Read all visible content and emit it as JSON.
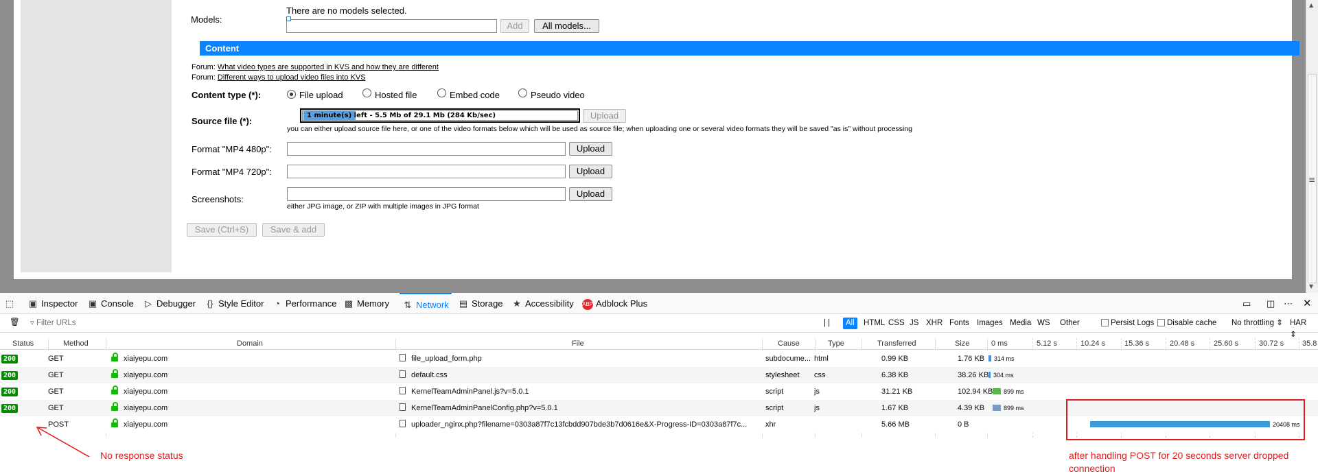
{
  "form": {
    "models_label": "Models:",
    "models_empty": "There are no models selected.",
    "add_button": "Add",
    "all_models_button": "All models...",
    "section_title": "Content",
    "forum_prefix": "Forum:",
    "forum_link_1": "What video types are supported in KVS and how they are different",
    "forum_link_2": "Different ways to upload video files into KVS",
    "content_type_label": "Content type (*):",
    "content_types": [
      "File upload",
      "Hosted file",
      "Embed code",
      "Pseudo video"
    ],
    "content_type_selected": "File upload",
    "source_file_label": "Source file (*):",
    "progress_highlight": "1 minute(s)",
    "progress_text": " left - 5.5 Mb of 29.1 Mb (284 Kb/sec)",
    "progress_fraction": 0.19,
    "upload_button": "Upload",
    "source_hint": "you can either upload source file here, or one of the video formats below which will be used as source file; when uploading one or several video formats they will be saved \"as is\" without processing",
    "format_480_label": "Format \"MP4 480p\":",
    "format_720_label": "Format \"MP4 720p\":",
    "screenshots_label": "Screenshots:",
    "screenshots_hint": "either JPG image, or ZIP with multiple images in JPG format",
    "save_button": "Save (Ctrl+S)",
    "save_add_button": "Save & add"
  },
  "devtools": {
    "tools": [
      "Inspector",
      "Console",
      "Debugger",
      "Style Editor",
      "Performance",
      "Memory",
      "Network",
      "Storage",
      "Accessibility",
      "Adblock Plus"
    ],
    "active_tool": "Network",
    "filter_placeholder": "Filter URLs",
    "pause_label": "| |",
    "type_filters": [
      "All",
      "HTML",
      "CSS",
      "JS",
      "XHR",
      "Fonts",
      "Images",
      "Media",
      "WS",
      "Other"
    ],
    "persist_logs": "Persist Logs",
    "disable_cache": "Disable cache",
    "throttling": "No throttling",
    "har": "HAR",
    "columns": [
      "Status",
      "Method",
      "Domain",
      "File",
      "Cause",
      "Type",
      "Transferred",
      "Size"
    ],
    "waterfall_ticks": [
      "0 ms",
      "5.12 s",
      "10.24 s",
      "15.36 s",
      "20.48 s",
      "25.60 s",
      "30.72 s",
      "35.8"
    ],
    "rows": [
      {
        "status": "200",
        "method": "GET",
        "domain": "xiaiyepu.com",
        "file": "file_upload_form.php",
        "cause": "subdocume...",
        "type": "html",
        "transferred": "0.99 KB",
        "size": "1.76 KB",
        "timing": "314 ms",
        "bar_color": "#4a90d9"
      },
      {
        "status": "200",
        "method": "GET",
        "domain": "xiaiyepu.com",
        "file": "default.css",
        "cause": "stylesheet",
        "type": "css",
        "transferred": "6.38 KB",
        "size": "38.26 KB",
        "timing": "304 ms",
        "bar_color": "#4a90d9"
      },
      {
        "status": "200",
        "method": "GET",
        "domain": "xiaiyepu.com",
        "file": "KernelTeamAdminPanel.js?v=5.0.1",
        "cause": "script",
        "type": "js",
        "transferred": "31.21 KB",
        "size": "102.94 KB",
        "timing": "899 ms",
        "bar_color": "#58b84a"
      },
      {
        "status": "200",
        "method": "GET",
        "domain": "xiaiyepu.com",
        "file": "KernelTeamAdminPanelConfig.php?v=5.0.1",
        "cause": "script",
        "type": "js",
        "transferred": "1.67 KB",
        "size": "4.39 KB",
        "timing": "899 ms",
        "bar_color": "#7a9cc4"
      },
      {
        "status": "",
        "method": "POST",
        "domain": "xiaiyepu.com",
        "file": "uploader_nginx.php?filename=0303a87f7c13fcbdd907bde3b7d0616e&X-Progress-ID=0303a87f7c...",
        "cause": "xhr",
        "type": "",
        "transferred": "5.66 MB",
        "size": "0 B",
        "timing": "20408 ms",
        "bar_color": "#3a9ad9"
      }
    ]
  },
  "annotations": {
    "no_status": "No response status",
    "dropped_line1": "after handling POST for 20 seconds server dropped",
    "dropped_line2": "connection"
  }
}
